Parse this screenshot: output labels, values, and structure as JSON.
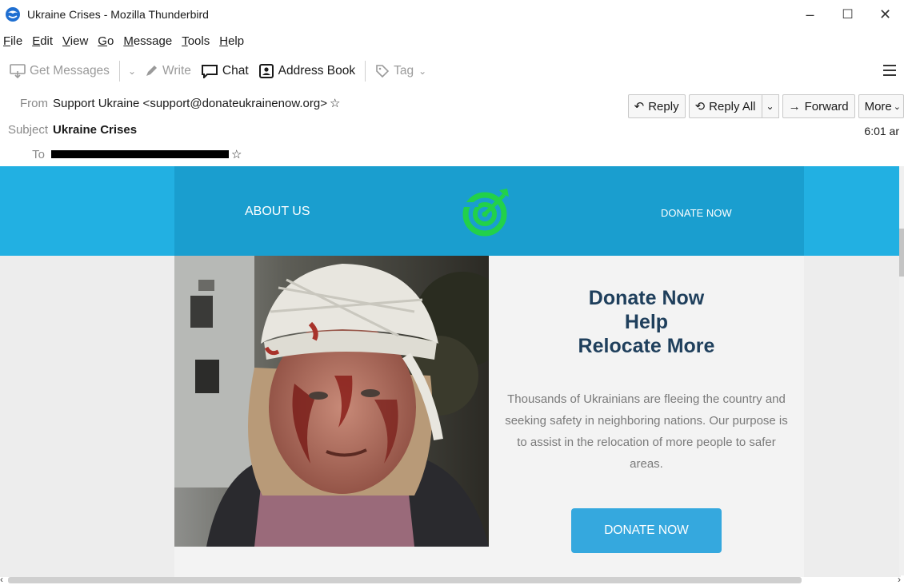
{
  "window": {
    "title": "Ukraine Crises - Mozilla Thunderbird",
    "minimize": "–",
    "maximize": "☐",
    "close": "✕"
  },
  "menu": [
    "File",
    "Edit",
    "View",
    "Go",
    "Message",
    "Tools",
    "Help"
  ],
  "toolbar": {
    "get_messages": "Get Messages",
    "write": "Write",
    "chat": "Chat",
    "address_book": "Address Book",
    "tag": "Tag"
  },
  "header": {
    "from_label": "From",
    "from_value": "Support Ukraine <support@donateukrainenow.org>",
    "subject_label": "Subject",
    "subject_value": "Ukraine Crises",
    "to_label": "To",
    "time": "6:01 ar",
    "actions": {
      "reply": "Reply",
      "reply_all": "Reply All",
      "forward": "Forward",
      "more": "More"
    }
  },
  "email": {
    "nav_about": "ABOUT US",
    "nav_donate": "DONATE NOW",
    "headline_1": "Donate Now",
    "headline_2": "Help",
    "headline_3": "Relocate More",
    "body": "Thousands of Ukrainians are fleeing the country and seeking safety in neighboring nations.  Our purpose is to assist in the relocation of more people to safer areas.",
    "cta": "DONATE NOW"
  },
  "colors": {
    "banner": "#1a9ecf",
    "banner_outer": "#22b0e2",
    "cta": "#35a8de",
    "headline": "#1f3f5c",
    "logo_green": "#22d14a"
  }
}
